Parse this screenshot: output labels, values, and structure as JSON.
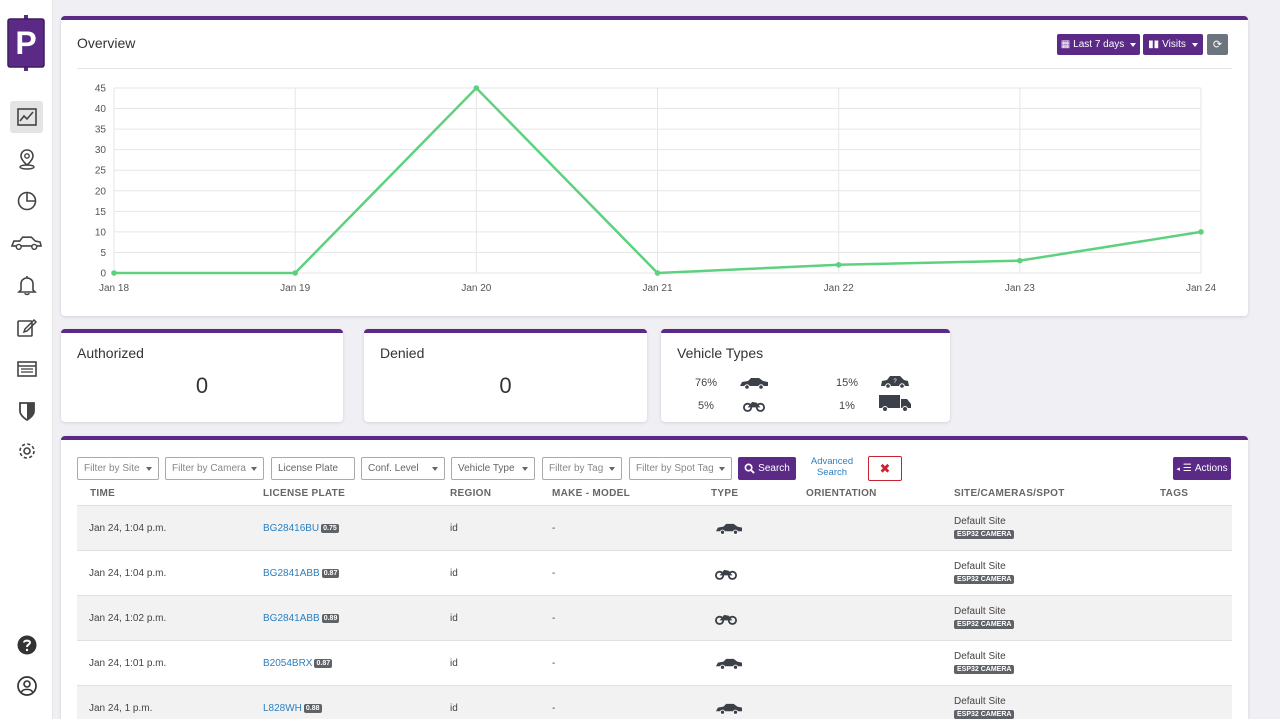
{
  "brand": {
    "logo_letter": "P"
  },
  "sidebar": {
    "items": [
      {
        "name": "dashboard-icon"
      },
      {
        "name": "location-pin-icon"
      },
      {
        "name": "pie-chart-icon"
      },
      {
        "name": "car-icon"
      },
      {
        "name": "bell-icon"
      },
      {
        "name": "edit-icon"
      },
      {
        "name": "list-icon"
      },
      {
        "name": "shield-icon"
      },
      {
        "name": "gear-icon"
      }
    ],
    "bottom": [
      {
        "name": "help-icon"
      },
      {
        "name": "user-icon"
      }
    ]
  },
  "overview": {
    "title": "Overview",
    "range_label": "Last 7 days",
    "metric_label": "Visits"
  },
  "chart_data": {
    "type": "line",
    "categories": [
      "Jan 18",
      "Jan 19",
      "Jan 20",
      "Jan 21",
      "Jan 22",
      "Jan 23",
      "Jan 24"
    ],
    "series": [
      {
        "values": [
          0,
          0,
          45,
          0,
          2,
          3,
          10
        ],
        "color": "#5ed17f"
      }
    ],
    "yticks": [
      "0",
      "5",
      "10",
      "15",
      "20",
      "25",
      "30",
      "35",
      "40",
      "45"
    ],
    "ylim": [
      0,
      45
    ],
    "grid": true
  },
  "stats": {
    "authorized": {
      "title": "Authorized",
      "value": "0"
    },
    "denied": {
      "title": "Denied",
      "value": "0"
    },
    "vehicle_types": {
      "title": "Vehicle Types",
      "items": [
        {
          "pct": "76%",
          "icon": "car-icon"
        },
        {
          "pct": "15%",
          "icon": "unknown-vehicle-icon"
        },
        {
          "pct": "5%",
          "icon": "motorcycle-icon"
        },
        {
          "pct": "1%",
          "icon": "truck-icon"
        }
      ]
    }
  },
  "filters": {
    "site": "Filter by Site",
    "camera": "Filter by Camera",
    "plate_placeholder": "License Plate",
    "conf": "Conf. Level",
    "vehicle_type": "Vehicle Type",
    "tag": "Filter by Tag",
    "spot_tag": "Filter by Spot Tag",
    "search": "Search",
    "advanced_line1": "Advanced",
    "advanced_line2": "Search",
    "actions": "Actions"
  },
  "table": {
    "headers": [
      "TIME",
      "LICENSE PLATE",
      "REGION",
      "MAKE - MODEL",
      "TYPE",
      "ORIENTATION",
      "SITE/CAMERAS/SPOT",
      "TAGS"
    ],
    "rows": [
      {
        "time": "Jan 24, 1:04 p.m.",
        "plate": "BG28416BU",
        "conf": "0.75",
        "region": "id",
        "make": "-",
        "type": "car-icon",
        "site": "Default Site",
        "camera": "ESP32 CAMERA"
      },
      {
        "time": "Jan 24, 1:04 p.m.",
        "plate": "BG2841ABB",
        "conf": "0.87",
        "region": "id",
        "make": "-",
        "type": "motorcycle-icon",
        "site": "Default Site",
        "camera": "ESP32 CAMERA"
      },
      {
        "time": "Jan 24, 1:02 p.m.",
        "plate": "BG2841ABB",
        "conf": "0.89",
        "region": "id",
        "make": "-",
        "type": "motorcycle-icon",
        "site": "Default Site",
        "camera": "ESP32 CAMERA"
      },
      {
        "time": "Jan 24, 1:01 p.m.",
        "plate": "B2054BRX",
        "conf": "0.87",
        "region": "id",
        "make": "-",
        "type": "car-icon",
        "site": "Default Site",
        "camera": "ESP32 CAMERA"
      },
      {
        "time": "Jan 24, 1 p.m.",
        "plate": "L828WH",
        "conf": "0.88",
        "region": "id",
        "make": "-",
        "type": "car-icon",
        "site": "Default Site",
        "camera": "ESP32 CAMERA"
      }
    ]
  },
  "colors": {
    "accent": "#5b2a86",
    "line": "#5ed17f",
    "link": "#2a7fc1",
    "danger": "#c82333"
  }
}
